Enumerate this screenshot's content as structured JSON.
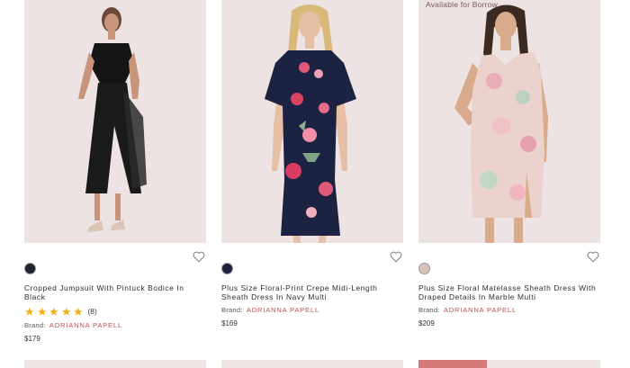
{
  "products": [
    {
      "title": "Cropped Jumpsuit With Pintuck Bodice In Black",
      "rating_stars": 5,
      "review_count": "(8)",
      "brand_label": "Brand:",
      "brand_name": "ADRIANNA PAPELL",
      "price": "$179",
      "swatch_color": "#1f2433",
      "photo_bg": "#ece3e2"
    },
    {
      "title": "Plus Size Floral-Print Crepe Midi-Length Sheath Dress In Navy Multi",
      "brand_label": "Brand:",
      "brand_name": "ADRIANNA PAPELL",
      "price": "$169",
      "swatch_color": "#1d2140",
      "photo_bg": "#ece3e2"
    },
    {
      "badge": "Available for Borrow",
      "title": "Plus Size Floral Matelasse Sheath Dress With Draped Details In Marble Multi",
      "brand_label": "Brand:",
      "brand_name": "ADRIANNA PAPELL",
      "price": "$209",
      "swatch_color": "#d7c2bd",
      "photo_bg": "#ece3e2"
    }
  ],
  "colors": {
    "star": "#f2b01e",
    "brand": "#c0504f",
    "sale_tag": "#d57a78"
  },
  "icons": [
    "heart-outline-icon",
    "star-icon"
  ]
}
